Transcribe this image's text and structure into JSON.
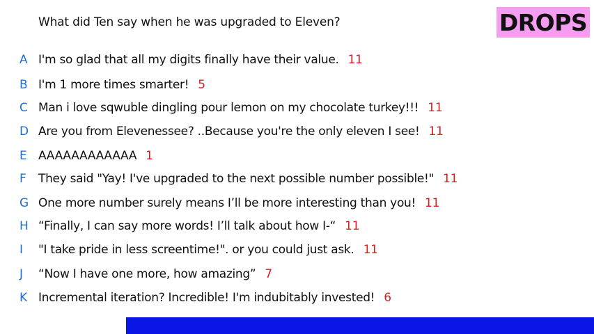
{
  "question": "What did Ten say when he was upgraded to Eleven?",
  "badge": "DROPS",
  "colors": {
    "badge_bg": "#f59df0",
    "letter": "#1f6fd8",
    "score": "#d61f1f",
    "bottom_bar": "#0a16e6",
    "text": "#111111"
  },
  "answers": [
    {
      "letter": "A",
      "text": "I'm so glad that all my digits finally have their value.",
      "score": "11"
    },
    {
      "letter": "B",
      "text": "I'm 1 more times smarter!",
      "score": "5"
    },
    {
      "letter": "C",
      "text": "Man i love sqwuble dingling pour lemon on my chocolate turkey!!!",
      "score": "11"
    },
    {
      "letter": "D",
      "text": "Are you from Elevenessee? ..Because you're the only eleven I see!",
      "score": "11"
    },
    {
      "letter": "E",
      "text": "AAAAAAAAAAAA",
      "score": "1"
    },
    {
      "letter": "F",
      "text": "They said \"Yay! I've upgraded to the next possible number possible!\"",
      "score": "11"
    },
    {
      "letter": "G",
      "text": "One more number surely means I’ll be more interesting than you!",
      "score": "11"
    },
    {
      "letter": "H",
      "text": "“Finally, I can say more words! I’ll talk about how I-“",
      "score": "11"
    },
    {
      "letter": "I",
      "text": "\"I take pride in less screentime!\". or you could just ask.",
      "score": "11"
    },
    {
      "letter": "J",
      "text": "“Now I have one more, how amazing”",
      "score": "7"
    },
    {
      "letter": "K",
      "text": "Incremental iteration?  Incredible!  I'm indubitably invested!",
      "score": "6"
    }
  ]
}
